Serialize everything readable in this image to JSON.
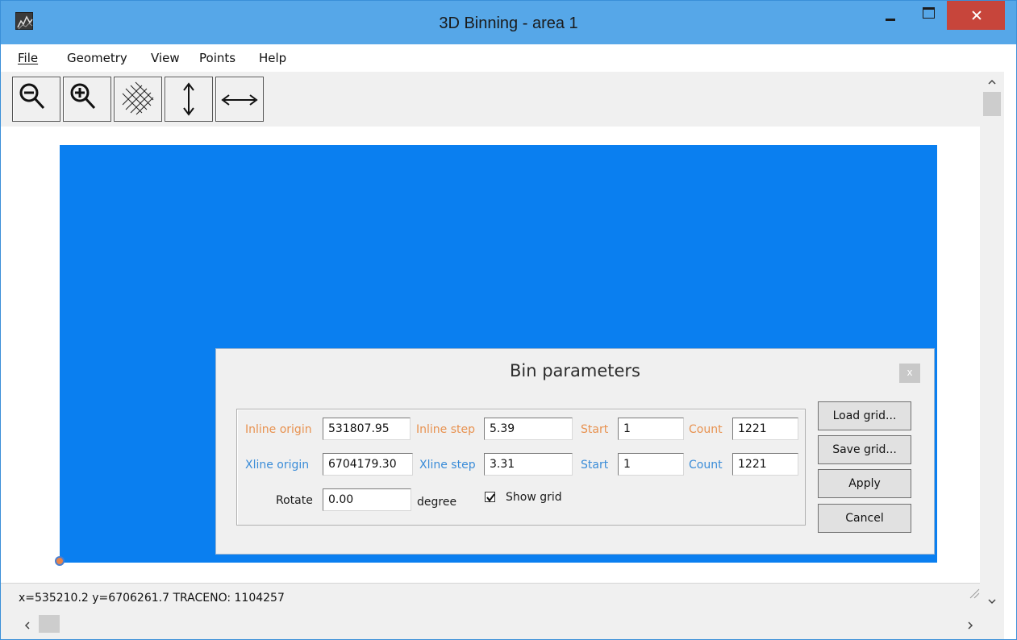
{
  "window": {
    "title": "3D Binning - area 1",
    "app_icon": "terrain-icon"
  },
  "menu": {
    "file": "File",
    "geometry": "Geometry",
    "view": "View",
    "points": "Points",
    "help": "Help"
  },
  "toolbar": {
    "zoom_out_icon": "zoom-out-icon",
    "zoom_in_icon": "zoom-in-icon",
    "grid_icon": "grid-icon",
    "vertical_arrow_icon": "vertical-arrow-icon",
    "horizontal_arrow_icon": "horizontal-arrow-icon"
  },
  "canvas": {
    "area_color": "#0a7ff0",
    "origin_color": "#e8844a"
  },
  "dialog": {
    "title": "Bin parameters",
    "close_label": "x",
    "inline": {
      "origin_label": "Inline origin",
      "origin_value": "531807.95",
      "step_label": "Inline step",
      "step_value": "5.39",
      "start_label": "Start",
      "start_value": "1",
      "count_label": "Count",
      "count_value": "1221"
    },
    "xline": {
      "origin_label": "Xline origin",
      "origin_value": "6704179.30",
      "step_label": "Xline step",
      "step_value": "3.31",
      "start_label": "Start",
      "start_value": "1",
      "count_label": "Count",
      "count_value": "1221"
    },
    "rotate": {
      "label": "Rotate",
      "value": "0.00",
      "unit": "degree"
    },
    "show_grid": {
      "label": "Show grid",
      "checked": true
    },
    "buttons": {
      "load": "Load grid...",
      "save": "Save grid...",
      "apply": "Apply",
      "cancel": "Cancel"
    }
  },
  "status": {
    "text": "x=535210.2 y=6706261.7 TRACENO: 1104257"
  }
}
